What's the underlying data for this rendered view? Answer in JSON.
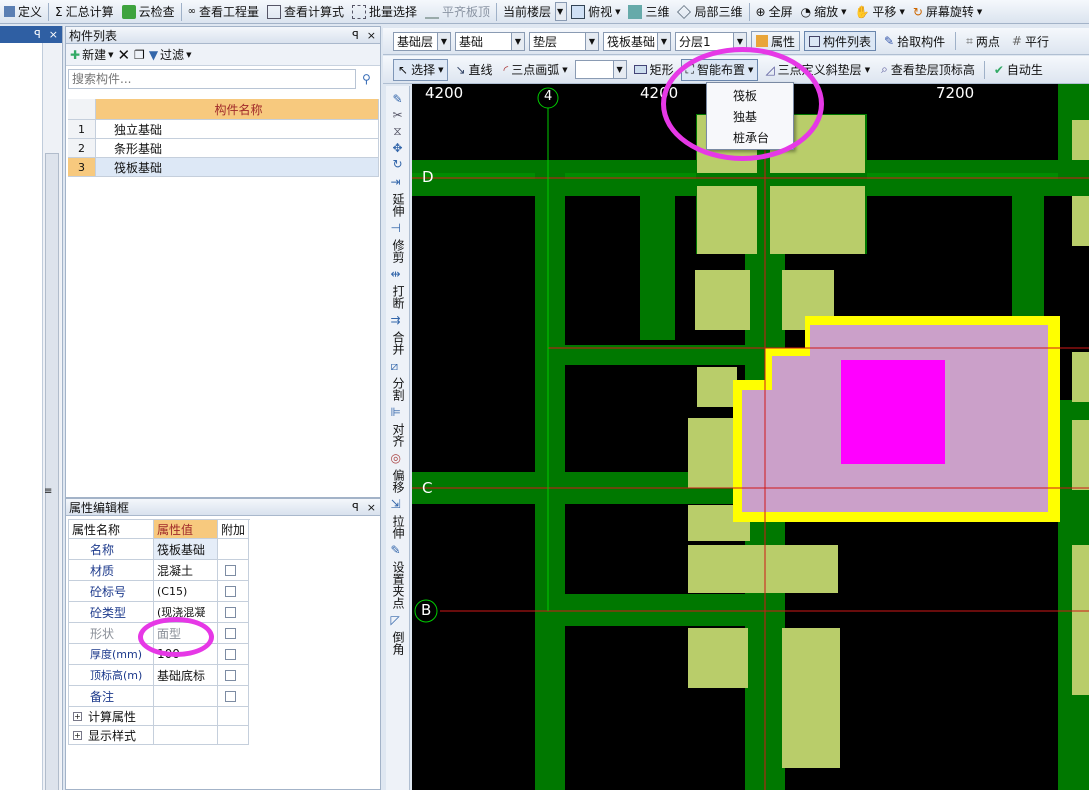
{
  "toolbar1": {
    "items": [
      "定义",
      "汇总计算",
      "云检查",
      "查看工程量",
      "查看计算式",
      "批量选择",
      "平齐板顶",
      "当前楼层",
      "俯视",
      "三维",
      "局部三维",
      "全屏",
      "缩放",
      "平移",
      "屏幕旋转"
    ]
  },
  "comp_panel": {
    "title": "构件列表",
    "new_label": "新建",
    "filter_label": "过滤",
    "search_placeholder": "搜索构件...",
    "header": "构件名称",
    "rows": [
      {
        "num": "1",
        "name": "独立基础"
      },
      {
        "num": "2",
        "name": "条形基础"
      },
      {
        "num": "3",
        "name": "筏板基础"
      }
    ]
  },
  "prop_panel": {
    "title": "属性编辑框",
    "headers": [
      "属性名称",
      "属性值",
      "附加"
    ],
    "rows": [
      {
        "name": "名称",
        "value": "筏板基础"
      },
      {
        "name": "材质",
        "value": "混凝土"
      },
      {
        "name": "砼标号",
        "value": "(C15)"
      },
      {
        "name": "砼类型",
        "value": "(现浇混凝"
      },
      {
        "name": "形状",
        "value": "面型"
      },
      {
        "name": "厚度(mm)",
        "value": "100"
      },
      {
        "name": "顶标高(m)",
        "value": "基础底标"
      },
      {
        "name": "备注",
        "value": ""
      }
    ],
    "groups": [
      "计算属性",
      "显示样式"
    ]
  },
  "toolbar2": {
    "floor_combo": "基础层",
    "type_combo": "基础",
    "layer_combo": "垫层",
    "comp_combo": "筏板基础",
    "sublayer_combo": "分层1",
    "props_btn": "属性",
    "complist_btn": "构件列表",
    "pick_btn": "拾取构件",
    "two_point": "两点",
    "parallel": "平行"
  },
  "toolbar3": {
    "select": "选择",
    "line": "直线",
    "arc": "三点画弧",
    "rect": "矩形",
    "smart": "智能布置",
    "slope": "三点定义斜垫层",
    "view_top": "查看垫层顶标高",
    "auto": "自动生"
  },
  "smart_menu": [
    "筏板",
    "独基",
    "桩承台"
  ],
  "left_tools": [
    "延伸",
    "修剪",
    "打断",
    "合并",
    "分割",
    "对齐",
    "偏移",
    "拉伸",
    "设置夹点",
    "倒角"
  ],
  "canvas": {
    "dims": [
      "4200",
      "4200",
      "7200"
    ],
    "axis_col": "4",
    "axis_rows": [
      "D",
      "C",
      "B"
    ]
  },
  "colors": {
    "green_dark": "#007800",
    "green_light": "#b9cd6a",
    "pink": "#cba0c9",
    "magenta": "#ff00ff",
    "yellow": "#ffff00",
    "highlight": "#e638e6"
  }
}
